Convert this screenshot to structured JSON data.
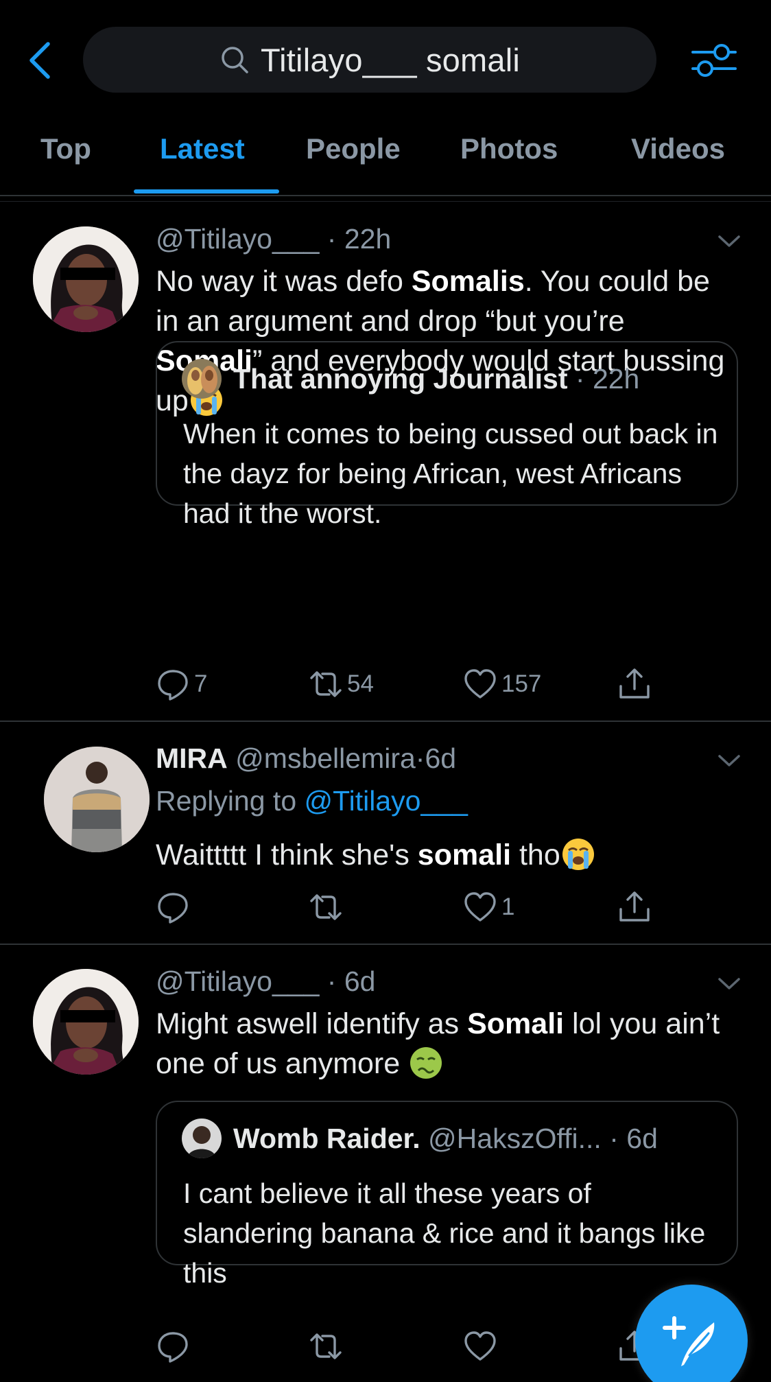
{
  "header": {
    "search_query": "Titilayo___ somali",
    "icons": {
      "back": "chevron-left-icon",
      "search": "search-icon",
      "filter": "filter-sliders-icon"
    },
    "accent_color": "#1d9bf0"
  },
  "tabs": [
    {
      "label": "Top",
      "active": false
    },
    {
      "label": "Latest",
      "active": true
    },
    {
      "label": "People",
      "active": false
    },
    {
      "label": "Photos",
      "active": false
    },
    {
      "label": "Videos",
      "active": false
    }
  ],
  "tweets": [
    {
      "handle": "@Titilayo___",
      "sep": "·",
      "time": "22h",
      "text_parts": [
        "No way it was defo ",
        "Somalis",
        ".  You could be in an argument and drop “but you’re ",
        "Somali",
        "” and everybody would start bussing up"
      ],
      "emoji": "loudly-crying-face",
      "quote": {
        "name": "That annoying Journalist",
        "sep": "·",
        "time": "22h",
        "text": "When it comes to being cussed out back in the dayz for being African, west Africans had it the worst."
      },
      "replies": "7",
      "retweets": "54",
      "likes": "157"
    },
    {
      "name": "MIRA",
      "handle": "@msbellemira",
      "sep": "·",
      "time": "6d",
      "replying_prefix": "Replying to ",
      "replying_to": "@Titilayo___",
      "text_parts": [
        "Waittttt I think she's ",
        "somali",
        " tho"
      ],
      "emoji": "loudly-crying-face",
      "replies": "",
      "retweets": "",
      "likes": "1"
    },
    {
      "handle": "@Titilayo___",
      "sep": "·",
      "time": "6d",
      "text_parts": [
        "Might aswell identify as ",
        "Somali",
        " lol you ain’t one of us anymore "
      ],
      "emoji": "nauseated-face",
      "quote": {
        "name": "Womb Raider.",
        "handle": "@HakszOffi...",
        "sep": "·",
        "time": "6d",
        "text": "I cant believe it all these years of slandering banana & rice and it bangs like this"
      },
      "replies": "",
      "retweets": "",
      "likes": ""
    }
  ],
  "fab": {
    "icon": "compose-tweet-icon"
  }
}
